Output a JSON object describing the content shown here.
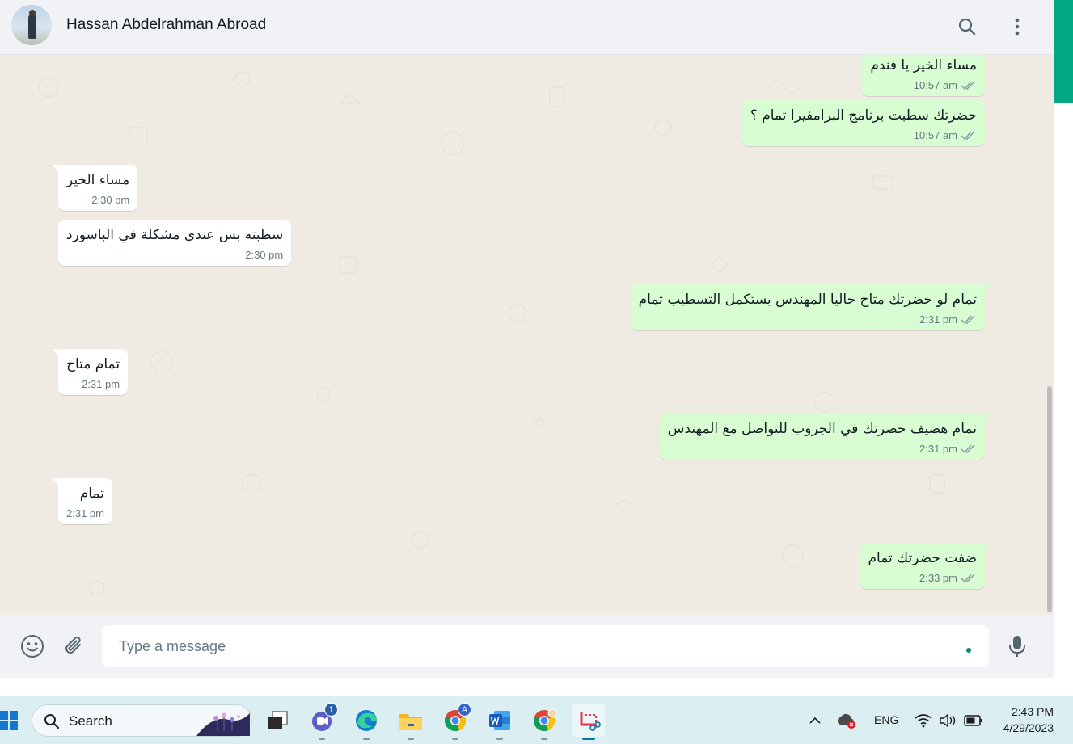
{
  "header": {
    "contact_name": "Hassan Abdelrahman Abroad",
    "search_icon": "search-icon",
    "menu_icon": "kebab-menu-icon"
  },
  "messages": [
    {
      "direction": "out",
      "text": "مساء الخير يا فندم",
      "time": "10:57 am",
      "status": "double-check"
    },
    {
      "direction": "out",
      "text": "حضرتك سطبت برنامج البرامفيرا تمام ؟",
      "time": "10:57 am",
      "status": "double-check"
    },
    {
      "direction": "in",
      "text": "مساء الخير",
      "time": "2:30 pm"
    },
    {
      "direction": "in",
      "text": "سطبته بس عندي مشكلة في الباسورد",
      "time": "2:30 pm"
    },
    {
      "direction": "out",
      "text": "تمام لو حضرتك متاح حاليا المهندس يستكمل التسطيب تمام",
      "time": "2:31 pm",
      "status": "double-check"
    },
    {
      "direction": "in",
      "text": "تمام متاح",
      "time": "2:31 pm"
    },
    {
      "direction": "out",
      "text": "تمام هضيف حضرتك في الجروب للتواصل مع المهندس",
      "time": "2:31 pm",
      "status": "double-check"
    },
    {
      "direction": "in",
      "text": "تمام",
      "time": "2:31 pm"
    },
    {
      "direction": "out",
      "text": "ضفت حضرتك تمام",
      "time": "2:33 pm",
      "status": "double-check"
    }
  ],
  "compose": {
    "placeholder": "Type a message",
    "emoji_icon": "emoji-icon",
    "attach_icon": "paperclip-icon",
    "mic_icon": "microphone-icon"
  },
  "taskbar": {
    "search_label": "Search",
    "apps": [
      {
        "name": "task-view",
        "icon": "task-view-icon"
      },
      {
        "name": "teams",
        "icon": "teams-icon",
        "badge": "1"
      },
      {
        "name": "edge",
        "icon": "edge-icon"
      },
      {
        "name": "file-explorer",
        "icon": "folder-icon"
      },
      {
        "name": "chrome-profile-a",
        "icon": "chrome-icon",
        "badge": "A"
      },
      {
        "name": "word",
        "icon": "word-icon"
      },
      {
        "name": "chrome-profile-2",
        "icon": "chrome-icon"
      },
      {
        "name": "snipping-tool",
        "icon": "snipping-tool-icon"
      }
    ],
    "language": "ENG",
    "time": "2:43 PM",
    "date": "4/29/2023"
  },
  "colors": {
    "accent": "#00a884",
    "outgoing_bubble": "#d9fdd3",
    "incoming_bubble": "#ffffff",
    "chat_background": "#efeae2"
  }
}
